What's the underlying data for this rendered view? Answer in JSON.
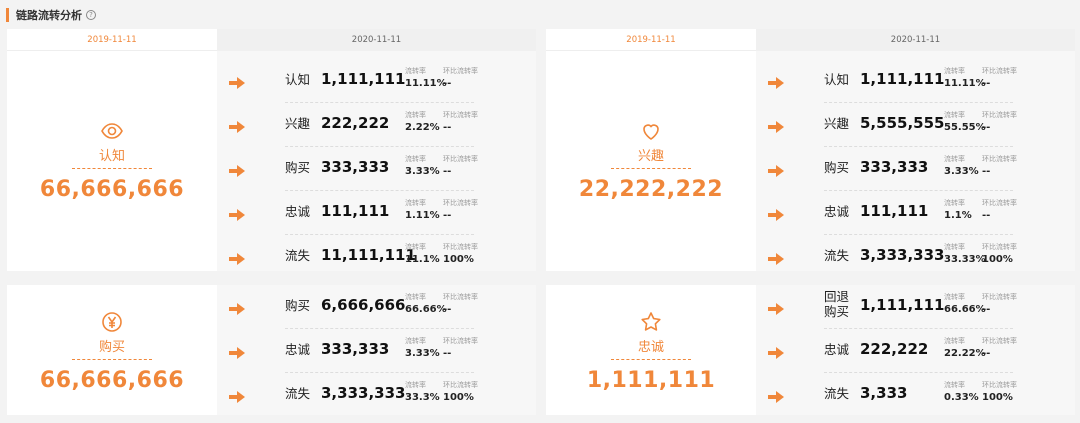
{
  "header": {
    "title": "链路流转分析",
    "help_icon": "?"
  },
  "labels": {
    "rate": "流转率",
    "mom": "环比流转率"
  },
  "panels": [
    {
      "date_left": "2019-11-11",
      "date_right": "2020-11-11",
      "stage": {
        "icon": "eye-icon",
        "label": "认知",
        "value": "66,666,666"
      },
      "rows": [
        {
          "name": "认知",
          "value": "1,111,111",
          "rate": "11.11%",
          "mom": "--"
        },
        {
          "name": "兴趣",
          "value": "222,222",
          "rate": "2.22%",
          "mom": "--"
        },
        {
          "name": "购买",
          "value": "333,333",
          "rate": "3.33%",
          "mom": "--"
        },
        {
          "name": "忠诚",
          "value": "111,111",
          "rate": "1.11%",
          "mom": "--"
        },
        {
          "name": "流失",
          "value": "11,111,111",
          "rate": "11.1%",
          "mom": "100%"
        }
      ]
    },
    {
      "date_left": "2019-11-11",
      "date_right": "2020-11-11",
      "stage": {
        "icon": "heart-icon",
        "label": "兴趣",
        "value": "22,222,222"
      },
      "rows": [
        {
          "name": "认知",
          "value": "1,111,111",
          "rate": "11.11%",
          "mom": "--"
        },
        {
          "name": "兴趣",
          "value": "5,555,555",
          "rate": "55.55%",
          "mom": "--"
        },
        {
          "name": "购买",
          "value": "333,333",
          "rate": "3.33%",
          "mom": "--"
        },
        {
          "name": "忠诚",
          "value": "111,111",
          "rate": "1.1%",
          "mom": "--"
        },
        {
          "name": "流失",
          "value": "3,333,333",
          "rate": "33.33%",
          "mom": "100%"
        }
      ]
    },
    {
      "stage": {
        "icon": "yen-icon",
        "label": "购买",
        "value": "66,666,666"
      },
      "rows": [
        {
          "name": "购买",
          "value": "6,666,666",
          "rate": "66.66%",
          "mom": "--"
        },
        {
          "name": "忠诚",
          "value": "333,333",
          "rate": "3.33%",
          "mom": "--"
        },
        {
          "name": "流失",
          "value": "3,333,333",
          "rate": "33.3%",
          "mom": "100%"
        }
      ]
    },
    {
      "stage": {
        "icon": "star-icon",
        "label": "忠诚",
        "value": "1,111,111"
      },
      "rows": [
        {
          "name": "回退购买",
          "value": "1,111,111",
          "rate": "66.66%",
          "mom": "--"
        },
        {
          "name": "忠诚",
          "value": "222,222",
          "rate": "22.22%",
          "mom": "--"
        },
        {
          "name": "流失",
          "value": "3,333",
          "rate": "0.33%",
          "mom": "100%"
        }
      ]
    }
  ],
  "colors": {
    "accent": "#f0873a"
  }
}
